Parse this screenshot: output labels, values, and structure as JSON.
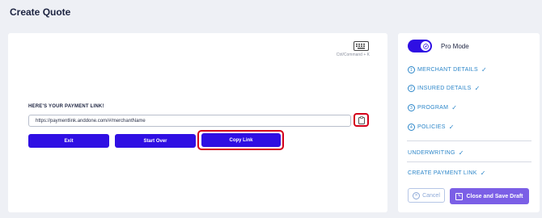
{
  "page": {
    "title": "Create Quote"
  },
  "main": {
    "keyboard_hint": "Ctrl/Command + K",
    "link_heading": "HERE'S YOUR PAYMENT LINK!",
    "link_value": "https://paymentlink.anddone.com/#/merchantName",
    "buttons": {
      "exit": "Exit",
      "start_over": "Start Over",
      "copy_link": "Copy Link"
    }
  },
  "sidebar": {
    "pro_mode_label": "Pro Mode",
    "pro_mode_on": true,
    "steps": [
      {
        "num": "1",
        "label": "MERCHANT DETAILS"
      },
      {
        "num": "2",
        "label": "INSURED DETAILS"
      },
      {
        "num": "3",
        "label": "PROGRAM"
      },
      {
        "num": "4",
        "label": "POLICIES"
      }
    ],
    "sections": [
      {
        "label": "UNDERWRITING"
      },
      {
        "label": "CREATE PAYMENT LINK"
      }
    ],
    "cancel_label": "Cancel",
    "save_label": "Close and Save Draft"
  },
  "colors": {
    "primary": "#2f0fe3",
    "accent_link": "#2c86c9",
    "highlight": "#d4001a",
    "save": "#7b5fe6"
  }
}
